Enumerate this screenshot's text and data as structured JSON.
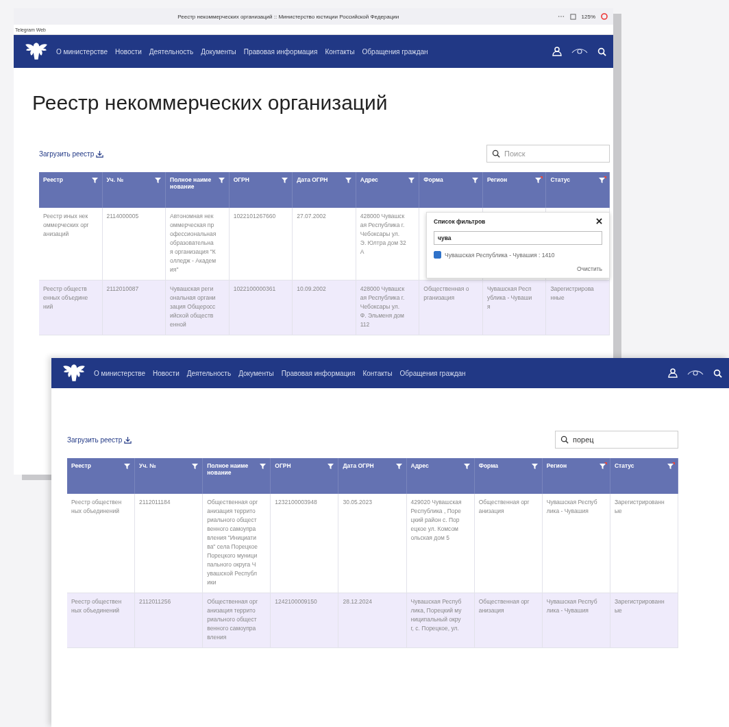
{
  "back_window": {
    "browser": {
      "page_title": "Реестр некоммерческих организаций :: Министерство юстиции Российской Федерации",
      "zoom": "125%",
      "bookmark": "Telegram Web"
    },
    "nav": [
      "О министерстве",
      "Новости",
      "Деятельность",
      "Документы",
      "Правовая информация",
      "Контакты",
      "Обращения граждан"
    ],
    "heading": "Реестр некоммерческих организаций",
    "download_label": "Загрузить реестр",
    "search": {
      "placeholder": "Поиск"
    },
    "columns": [
      {
        "label": "Реестр",
        "filtered": false
      },
      {
        "label": "Уч. №",
        "filtered": false
      },
      {
        "label": "Полное наименование",
        "filtered": false
      },
      {
        "label": "ОГРН",
        "filtered": false
      },
      {
        "label": "Дата ОГРН",
        "filtered": false
      },
      {
        "label": "Адрес",
        "filtered": false
      },
      {
        "label": "Форма",
        "filtered": false
      },
      {
        "label": "Регион",
        "filtered": true
      },
      {
        "label": "Статус",
        "filtered": true
      }
    ],
    "rows": [
      {
        "cells": [
          "Реестр иных некоммерческих организаций",
          "2114000005",
          "Автономная некоммерческая профессиональная образовательная организация \"Колледж - Академия\"",
          "1022101267660",
          "27.07.2002",
          "428000 Чувашская Республика г. Чебоксары ул. Э. Юлтра дом 32 А",
          "",
          "",
          ""
        ]
      },
      {
        "cells": [
          "Реестр общественных объединений",
          "2112010087",
          "Чувашская региональная организация Общероссийской общественной",
          "1022100000361",
          "10.09.2002",
          "428000 Чувашская Республика г. Чебоксары ул. Ф. Эльменя дом 112",
          "Общественная организация",
          "Чувашская Республика - Чувашия",
          "Зарегистрированные"
        ]
      }
    ],
    "filter_popup": {
      "title": "Список фильтров",
      "query": "чува",
      "options": [
        {
          "label": "Чувашская Республика - Чувашия : 1410",
          "checked": true
        }
      ],
      "clear_label": "Очистить"
    }
  },
  "front_window": {
    "nav": [
      "О министерстве",
      "Новости",
      "Деятельность",
      "Документы",
      "Правовая информация",
      "Контакты",
      "Обращения граждан"
    ],
    "download_label": "Загрузить реестр",
    "search": {
      "value": "порец"
    },
    "columns": [
      {
        "label": "Реестр",
        "filtered": false
      },
      {
        "label": "Уч. №",
        "filtered": false
      },
      {
        "label": "Полное наименование",
        "filtered": false
      },
      {
        "label": "ОГРН",
        "filtered": false
      },
      {
        "label": "Дата ОГРН",
        "filtered": false
      },
      {
        "label": "Адрес",
        "filtered": false
      },
      {
        "label": "Форма",
        "filtered": false
      },
      {
        "label": "Регион",
        "filtered": true
      },
      {
        "label": "Статус",
        "filtered": true
      }
    ],
    "rows": [
      {
        "cells": [
          "Реестр общественных объединений",
          "2112011184",
          "Общественная организация территориального общественного самоуправления \"Инициатива\" села Порецкое Порецкого муниципального округа Чувашской Республики",
          "1232100003948",
          "30.05.2023",
          "429020 Чувашская Республика , Порецкий район с. Порецкое ул. Комсомольская дом 5",
          "Общественная организация",
          "Чувашская Республика - Чувашия",
          "Зарегистрированные"
        ]
      },
      {
        "cells": [
          "Реестр общественных объединений",
          "2112011256",
          "Общественная организация территориального общественного самоуправления",
          "1242100009150",
          "28.12.2024",
          "Чувашская Республика, Порецкий муниципальный округ, с. Порецкое, ул.",
          "Общественная организация",
          "Чувашская Республика - Чувашия",
          "Зарегистрированные"
        ]
      }
    ]
  }
}
